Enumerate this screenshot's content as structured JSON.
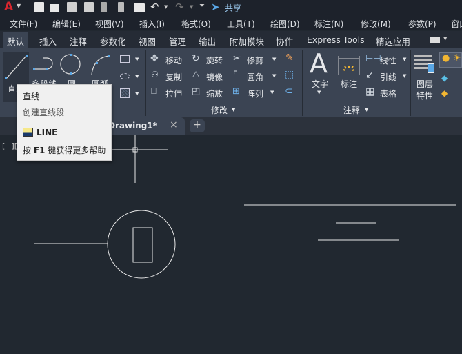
{
  "app": {
    "logo": "A",
    "share_label": "共享"
  },
  "menu": [
    "文件(F)",
    "编辑(E)",
    "视图(V)",
    "插入(I)",
    "格式(O)",
    "工具(T)",
    "绘图(D)",
    "标注(N)",
    "修改(M)",
    "参数(P)",
    "窗口"
  ],
  "ribbon_tabs": [
    "默认",
    "插入",
    "注释",
    "参数化",
    "视图",
    "管理",
    "输出",
    "附加模块",
    "协作",
    "Express Tools",
    "精选应用"
  ],
  "draw": {
    "line": "直线",
    "polyline": "多段线",
    "circle": "圆",
    "arc": "圆弧"
  },
  "modify": {
    "move": "移动",
    "rotate": "旋转",
    "trim": "修剪",
    "copy": "复制",
    "mirror": "镜像",
    "fillet": "圆角",
    "stretch": "拉伸",
    "scale": "缩放",
    "array": "阵列",
    "panel": "修改"
  },
  "annotation": {
    "text": "文字",
    "dimension": "标注",
    "linear": "线性",
    "leader": "引线",
    "table": "表格",
    "panel": "注释"
  },
  "layers": {
    "properties": "图层\n特性",
    "line1": "图层",
    "line2": "特性"
  },
  "doc_tab": {
    "name": "Drawing1*",
    "viewport": "[−][",
    "close": "×",
    "new": "+"
  },
  "tooltip": {
    "title": "直线",
    "desc": "创建直线段",
    "command": "LINE",
    "help_prefix": "按 ",
    "help_key": "F1",
    "help_suffix": " 键获得更多帮助"
  },
  "colors": {
    "ribbon": "#3b4453",
    "canvas": "#212830",
    "accent": "#5aa7e6",
    "logo": "#d9262e"
  }
}
